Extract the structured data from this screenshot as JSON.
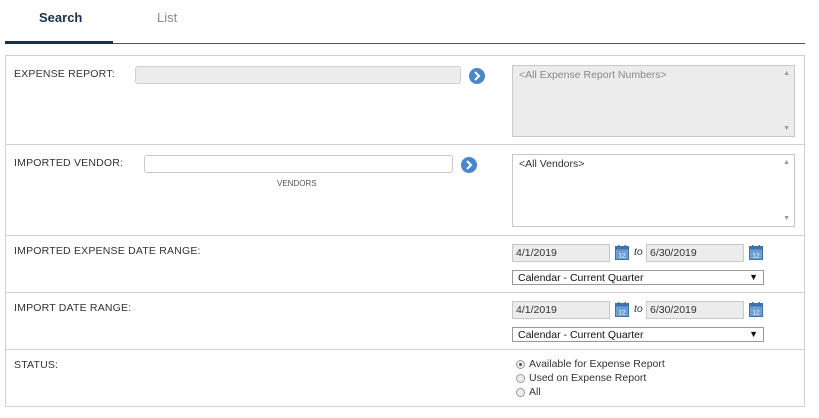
{
  "tabs": [
    {
      "label": "Search"
    },
    {
      "label": "List"
    }
  ],
  "form": {
    "expense_report": {
      "label": "EXPENSE REPORT:",
      "value": "",
      "list_items": [
        "<All Expense Report Numbers>"
      ]
    },
    "imported_vendor": {
      "label": "IMPORTED VENDOR:",
      "value": "",
      "sub_label": "VENDORS",
      "list_items": [
        "<All Vendors>"
      ]
    },
    "imported_expense_date_range": {
      "label": "IMPORTED EXPENSE DATE RANGE:",
      "from": "4/1/2019",
      "to_label": "to",
      "to": "6/30/2019",
      "preset": "Calendar - Current Quarter"
    },
    "import_date_range": {
      "label": "IMPORT DATE RANGE:",
      "from": "4/1/2019",
      "to_label": "to",
      "to": "6/30/2019",
      "preset": "Calendar - Current Quarter"
    },
    "status": {
      "label": "STATUS:",
      "options": [
        {
          "label": "Available for Expense Report",
          "checked": true
        },
        {
          "label": "Used on Expense Report",
          "checked": false
        },
        {
          "label": "All",
          "checked": false
        }
      ]
    }
  },
  "icons": {
    "go": "chevron-right-icon",
    "calendar": "calendar-icon",
    "dropdown": "triangle-down-icon"
  },
  "colors": {
    "accent": "#1c2f4a",
    "button_blue": "#4a86c8"
  }
}
